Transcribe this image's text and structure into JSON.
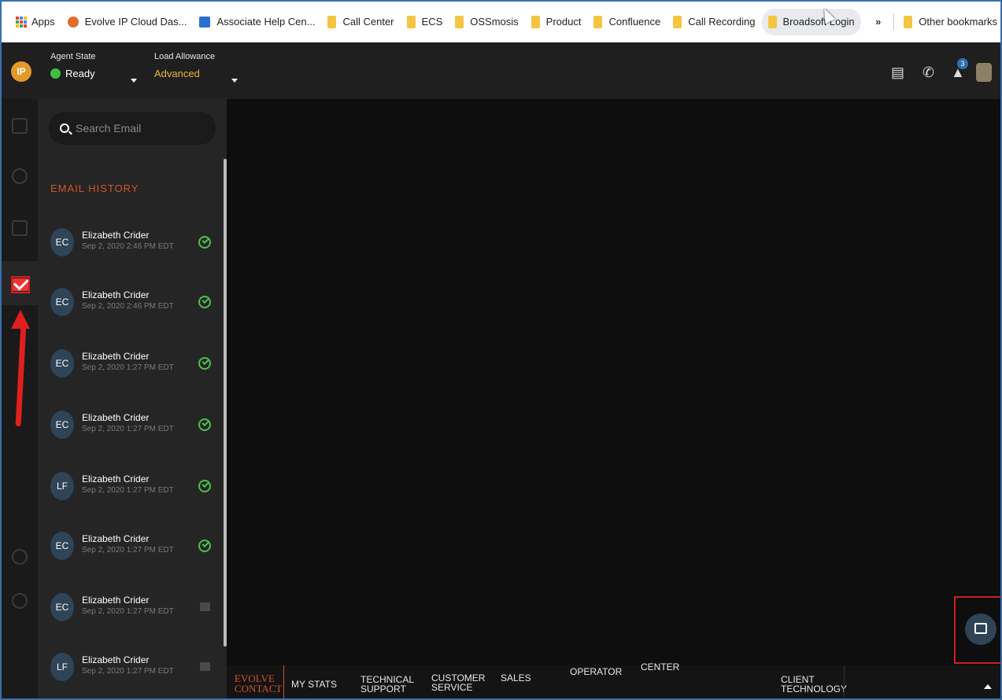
{
  "bookmarks": {
    "apps": "Apps",
    "items": [
      "Evolve IP Cloud Das...",
      "Associate Help Cen...",
      "Call Center",
      "ECS",
      "OSSmosis",
      "Product",
      "Confluence",
      "Call Recording",
      "Broadsoft Login"
    ],
    "more": "»",
    "other": "Other bookmarks"
  },
  "header": {
    "logo_text": "IP",
    "agent_state_label": "Agent State",
    "agent_state_value": "Ready",
    "load_allowance_label": "Load Allowance",
    "load_allowance_value": "Advanced",
    "notification_count": "3"
  },
  "search": {
    "placeholder": "Search Email"
  },
  "email_history": {
    "title": "EMAIL HISTORY",
    "items": [
      {
        "initials": "EC",
        "name": "Elizabeth Crider",
        "date": "Sep 2, 2020 2:46 PM EDT",
        "status": "done"
      },
      {
        "initials": "EC",
        "name": "Elizabeth Crider",
        "date": "Sep 2, 2020 2:46 PM EDT",
        "status": "done"
      },
      {
        "initials": "EC",
        "name": "Elizabeth Crider",
        "date": "Sep 2, 2020 1:27 PM EDT",
        "status": "done"
      },
      {
        "initials": "EC",
        "name": "Elizabeth Crider",
        "date": "Sep 2, 2020 1:27 PM EDT",
        "status": "done"
      },
      {
        "initials": "LF",
        "name": "Elizabeth Crider",
        "date": "Sep 2, 2020 1:27 PM EDT",
        "status": "done"
      },
      {
        "initials": "EC",
        "name": "Elizabeth Crider",
        "date": "Sep 2, 2020 1:27 PM EDT",
        "status": "done"
      },
      {
        "initials": "EC",
        "name": "Elizabeth Crider",
        "date": "Sep 2, 2020 1:27 PM EDT",
        "status": "unread"
      },
      {
        "initials": "LF",
        "name": "Elizabeth Crider",
        "date": "Sep 2, 2020 1:27 PM EDT",
        "status": "unread"
      }
    ]
  },
  "bottom_nav": {
    "brand_line1": "EVOLVE",
    "brand_line2": "CONTACT",
    "my_stats": "MY STATS",
    "technical_1": "TECHNICAL",
    "technical_2": "SUPPORT",
    "customer_1": "CUSTOMER",
    "customer_2": "SERVICE",
    "sales": "SALES",
    "operator": "OPERATOR",
    "center": "CENTER",
    "client_1": "CLIENT",
    "client_2": "TECHNOLOGY"
  },
  "colors": {
    "accent_orange": "#d2542a",
    "ready_green": "#3fbf3f",
    "load_allowance_yellow": "#e8b63a",
    "annotation_red": "#cc2020"
  }
}
